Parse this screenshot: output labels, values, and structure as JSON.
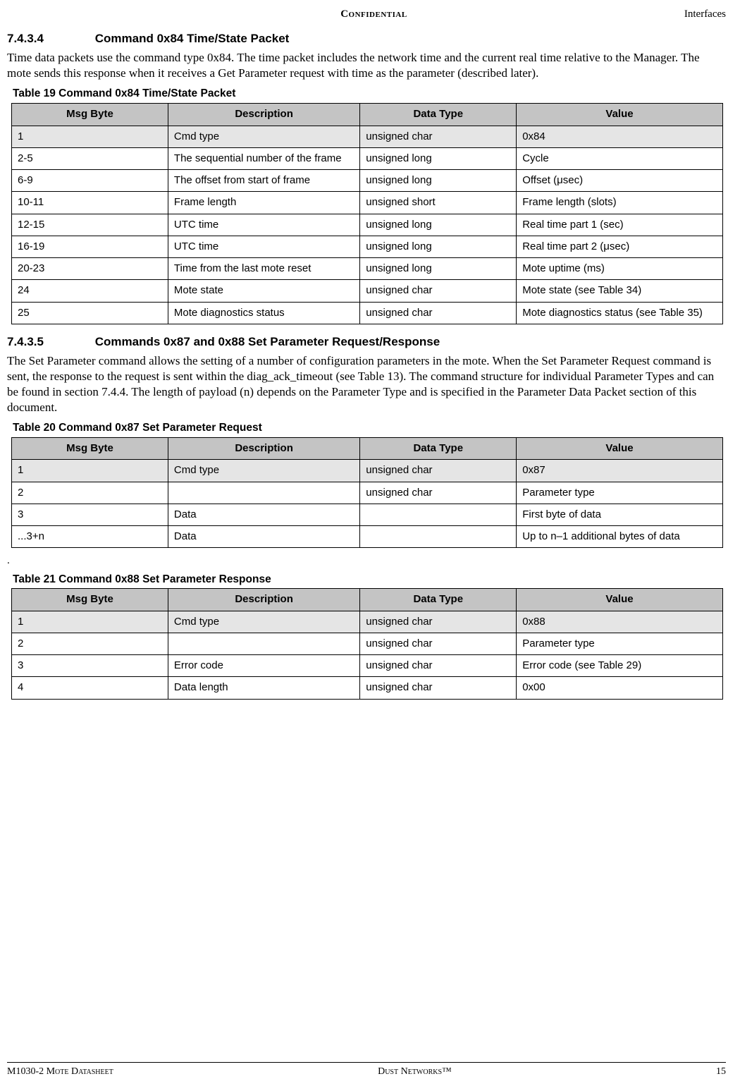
{
  "header": {
    "center": "Confidential",
    "right": "Interfaces"
  },
  "section1": {
    "num": "7.4.3.4",
    "title": "Command 0x84 Time/State Packet",
    "para": "Time data packets use the command type 0x84. The time packet includes the network time and the current real time relative to the Manager. The mote sends this response when it receives a Get Parameter request with time as the parameter (described later)."
  },
  "table19": {
    "caption": "Table 19    Command 0x84 Time/State Packet",
    "headers": [
      "Msg Byte",
      "Description",
      "Data Type",
      "Value"
    ],
    "rows": [
      [
        "1",
        "Cmd type",
        "unsigned char",
        "0x84"
      ],
      [
        "2-5",
        "The sequential number of the frame",
        "unsigned long",
        "Cycle"
      ],
      [
        "6-9",
        "The offset from start of frame",
        "unsigned long",
        "Offset (μsec)"
      ],
      [
        "10-11",
        "Frame length",
        "unsigned short",
        "Frame length (slots)"
      ],
      [
        "12-15",
        "UTC time",
        "unsigned long",
        "Real time part 1 (sec)"
      ],
      [
        "16-19",
        "UTC time",
        "unsigned long",
        "Real time part 2 (μsec)"
      ],
      [
        "20-23",
        "Time from the last mote reset",
        "unsigned long",
        "Mote uptime (ms)"
      ],
      [
        "24",
        "Mote state",
        "unsigned char",
        "Mote state (see Table 34)"
      ],
      [
        "25",
        "Mote diagnostics status",
        "unsigned char",
        "Mote diagnostics status (see Table 35)"
      ]
    ]
  },
  "section2": {
    "num": "7.4.3.5",
    "title": "Commands 0x87 and 0x88 Set Parameter Request/Response",
    "para": "The Set Parameter command allows the setting of a number of configuration parameters in the mote. When the Set Parameter Request command is sent, the response to the request is sent within the diag_ack_timeout (see Table 13). The command structure for individual Parameter Types and can be found in section 7.4.4. The length of payload (n) depends on the Parameter Type and is specified in the Parameter Data Packet section of this document."
  },
  "table20": {
    "caption": "Table 20    Command 0x87 Set Parameter Request",
    "headers": [
      "Msg Byte",
      "Description",
      "Data Type",
      "Value"
    ],
    "rows": [
      [
        "1",
        "Cmd type",
        "unsigned char",
        "0x87"
      ],
      [
        "2",
        "",
        "unsigned char",
        "Parameter type"
      ],
      [
        "3",
        "Data",
        "",
        "First byte of data"
      ],
      [
        " ...3+n",
        "Data",
        "",
        "Up to n–1 additional bytes of data"
      ]
    ]
  },
  "table21": {
    "caption": "Table 21    Command 0x88 Set Parameter Response",
    "headers": [
      "Msg Byte",
      "Description",
      "Data Type",
      "Value"
    ],
    "rows": [
      [
        "1",
        "Cmd type",
        "unsigned char",
        "0x88"
      ],
      [
        "2",
        "",
        "unsigned char",
        "Parameter type"
      ],
      [
        "3",
        "Error code",
        "unsigned char",
        "Error code (see Table 29)"
      ],
      [
        "4",
        "Data length",
        "unsigned char",
        "0x00"
      ]
    ]
  },
  "footer": {
    "left": "M1030-2 Mote Datasheet",
    "center": "Dust Networks™",
    "right": "15"
  }
}
